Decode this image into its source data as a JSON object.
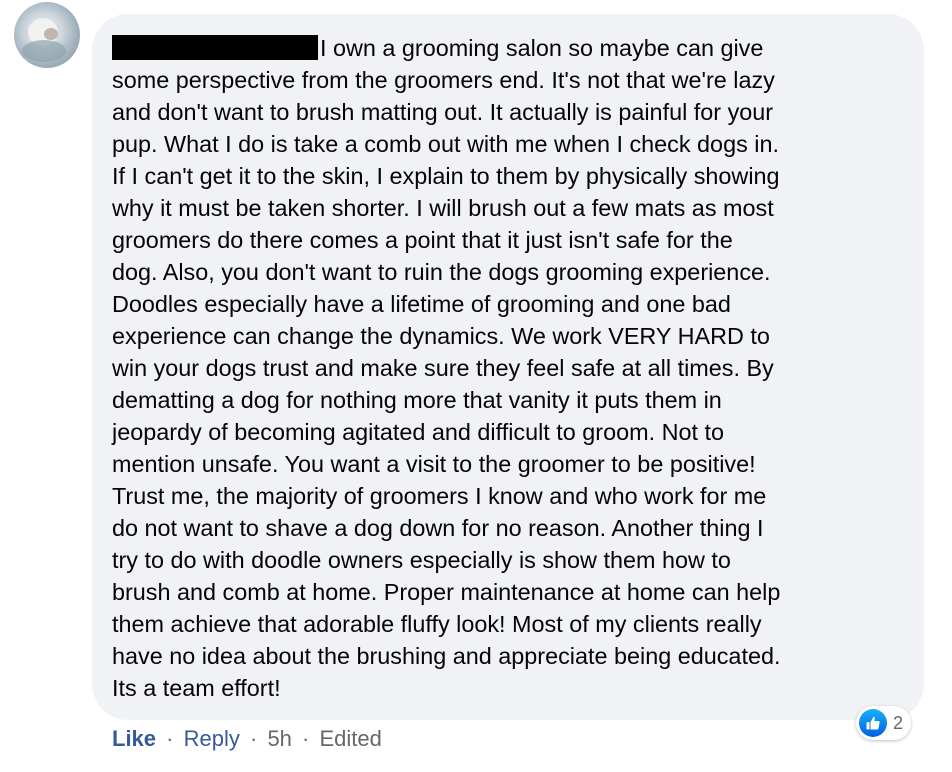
{
  "comment": {
    "author_redacted": true,
    "lines": [
      "I own a grooming salon so maybe can give",
      "some perspective from the groomers end. It's not that we're lazy",
      "and don't want to brush matting out. It actually is painful for your",
      "pup. What I do is take a comb out with me when I check dogs in.",
      "If I can't get it to the skin, I explain to them by physically showing",
      "why it must be taken shorter. I will brush out a few mats as most",
      "groomers do there comes a point that it just isn't safe for the",
      "dog. Also, you don't want to ruin the dogs grooming experience.",
      "Doodles especially have a lifetime of grooming and one bad",
      "experience can change the dynamics. We work VERY HARD to",
      "win your dogs trust and make sure they feel safe at all times. By",
      "dematting a dog for nothing more that vanity it puts them in",
      "jeopardy of becoming agitated and difficult to groom. Not to",
      "mention unsafe. You want a visit to the groomer to be positive!",
      "Trust me, the majority of groomers I know and who work for me",
      "do not want to shave a dog down for no reason. Another thing I",
      "try to do with doodle owners especially is show them how to",
      "brush and comb at home. Proper maintenance at home can help",
      "them achieve that adorable fluffy look! Most of my clients really",
      "have no idea about the brushing and appreciate being educated.",
      "Its a team effort!"
    ]
  },
  "reactions": {
    "icon": "thumbs-up-icon",
    "count": "2",
    "color": "#1877f2"
  },
  "actions": {
    "like": "Like",
    "reply": "Reply",
    "time": "5h",
    "edited": "Edited",
    "separator": "·"
  },
  "colors": {
    "bubble": "#f0f2f5",
    "link": "#385898",
    "meta": "#65676b",
    "text": "#050505"
  }
}
